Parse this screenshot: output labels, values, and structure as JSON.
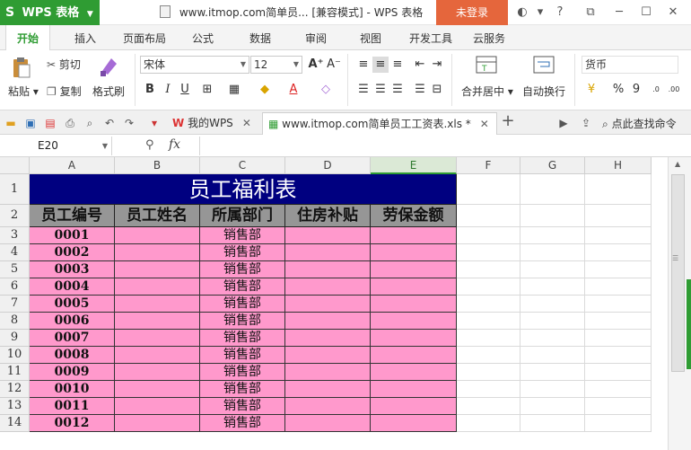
{
  "titlebar": {
    "app_name": "WPS 表格",
    "doc_title": "www.itmop.com简单员... [兼容模式] - WPS 表格",
    "login_label": "未登录",
    "icons": [
      "theme-icon",
      "shirt-icon",
      "help-icon",
      "restore-icon",
      "minimize-icon",
      "maximize-icon",
      "close-icon"
    ]
  },
  "tabs": [
    "开始",
    "插入",
    "页面布局",
    "公式",
    "数据",
    "审阅",
    "视图",
    "开发工具",
    "云服务"
  ],
  "ribbon": {
    "paste": "粘贴",
    "cut": "剪切",
    "copy": "复制",
    "format_painter": "格式刷",
    "font_name": "宋体",
    "font_size": "12",
    "merge_center": "合并居中",
    "wrap_text": "自动换行",
    "number_format": "货币",
    "percent": "%",
    "comma": "9"
  },
  "docbar": {
    "tab1": "我的WPS",
    "tab2": "www.itmop.com简单员工工资表.xls *",
    "search": "点此查找命令"
  },
  "formula": {
    "name_box": "E20",
    "fx": "fx",
    "value": ""
  },
  "columns": [
    "A",
    "B",
    "C",
    "D",
    "E",
    "F",
    "G",
    "H"
  ],
  "selected_column": "E",
  "rows": [
    "1",
    "2",
    "3",
    "4",
    "5",
    "6",
    "7",
    "8",
    "9",
    "10",
    "11",
    "12",
    "13",
    "14"
  ],
  "table": {
    "title": "员工福利表",
    "headers": [
      "员工编号",
      "员工姓名",
      "所属部门",
      "住房补贴",
      "劳保金额"
    ],
    "records": [
      {
        "id": "0001",
        "dept": "销售部"
      },
      {
        "id": "0002",
        "dept": "销售部"
      },
      {
        "id": "0003",
        "dept": "销售部"
      },
      {
        "id": "0004",
        "dept": "销售部"
      },
      {
        "id": "0005",
        "dept": "销售部"
      },
      {
        "id": "0006",
        "dept": "销售部"
      },
      {
        "id": "0007",
        "dept": "销售部"
      },
      {
        "id": "0008",
        "dept": "销售部"
      },
      {
        "id": "0009",
        "dept": "销售部"
      },
      {
        "id": "0010",
        "dept": "销售部"
      },
      {
        "id": "0011",
        "dept": "销售部"
      },
      {
        "id": "0012",
        "dept": "销售部"
      }
    ]
  },
  "colors": {
    "wps_green": "#2f9c33",
    "login_orange": "#e5663c",
    "title_navy": "#000080",
    "header_gray": "#969696",
    "data_pink": "#ff99cc"
  }
}
